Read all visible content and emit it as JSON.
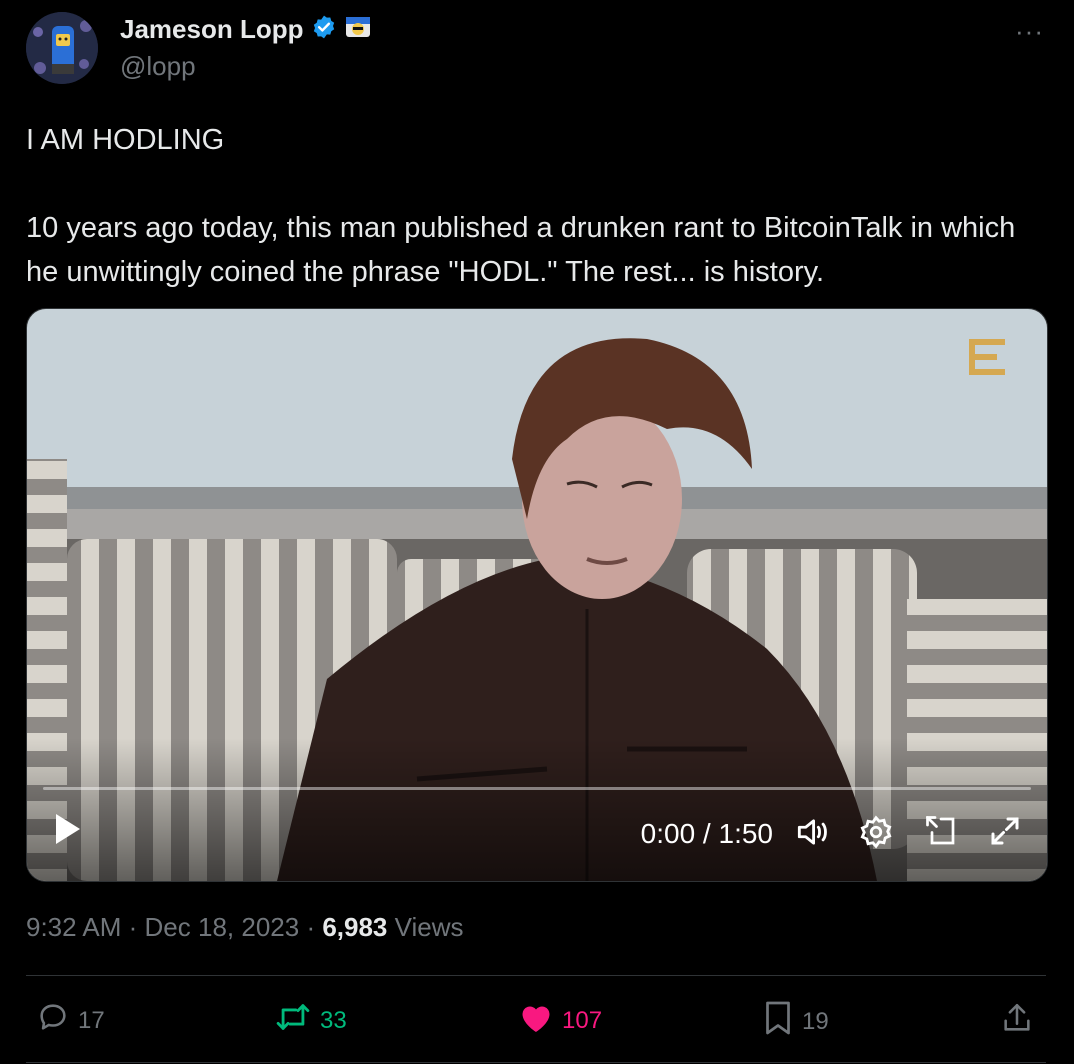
{
  "author": {
    "name": "Jameson Lopp",
    "handle": "@lopp"
  },
  "more_label": "···",
  "tweet": {
    "line1": "I AM HODLING",
    "line2": "10 years ago today, this man published a drunken rant to BitcoinTalk in which he unwittingly coined the phrase \"HODL.\" The rest... is history."
  },
  "video": {
    "time": "0:00 / 1:50",
    "progress": 0
  },
  "meta": {
    "time": "9:32 AM",
    "date": "Dec 18, 2023",
    "views": "6,983",
    "views_label": "Views"
  },
  "actions": {
    "replies": "17",
    "reposts": "33",
    "likes": "107",
    "bookmarks": "19"
  },
  "colors": {
    "verified": "#1d9bf0",
    "repost": "#00ba7c",
    "like": "#f91880",
    "muted": "#71767b"
  },
  "icons": [
    "verified-badge-icon",
    "affiliate-badge-icon",
    "more-icon",
    "play-icon",
    "volume-icon",
    "settings-icon",
    "picture-in-picture-icon",
    "fullscreen-icon",
    "reply-icon",
    "repost-icon",
    "like-icon",
    "bookmark-icon",
    "share-icon"
  ]
}
